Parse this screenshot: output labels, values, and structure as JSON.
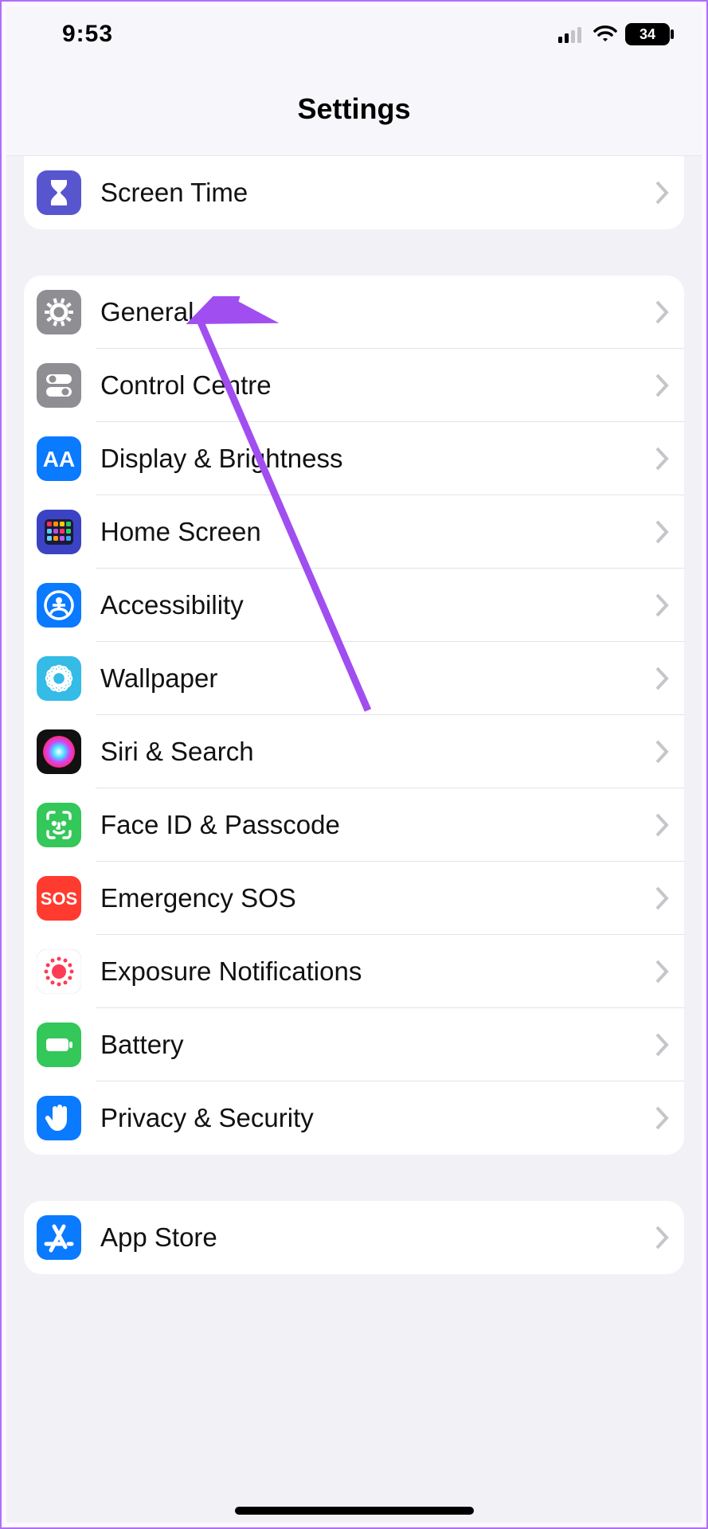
{
  "status_bar": {
    "time": "9:53",
    "battery_percent": "34"
  },
  "header": {
    "title": "Settings"
  },
  "groups": [
    {
      "partial_top": true,
      "rows": [
        {
          "key": "screen-time",
          "label": "Screen Time",
          "icon": "hourglass",
          "bg": "#5856cf"
        }
      ]
    },
    {
      "rows": [
        {
          "key": "general",
          "label": "General",
          "icon": "gear",
          "bg": "#8e8e93"
        },
        {
          "key": "control-centre",
          "label": "Control Centre",
          "icon": "toggles",
          "bg": "#8e8e93"
        },
        {
          "key": "display-brightness",
          "label": "Display & Brightness",
          "icon": "aa",
          "bg": "#0a7aff"
        },
        {
          "key": "home-screen",
          "label": "Home Screen",
          "icon": "homegrid",
          "bg": "#3b43c4"
        },
        {
          "key": "accessibility",
          "label": "Accessibility",
          "icon": "person-circle",
          "bg": "#0a7aff"
        },
        {
          "key": "wallpaper",
          "label": "Wallpaper",
          "icon": "flower",
          "bg": "#34bbe6"
        },
        {
          "key": "siri-search",
          "label": "Siri & Search",
          "icon": "siri",
          "bg": "#000000"
        },
        {
          "key": "faceid-passcode",
          "label": "Face ID & Passcode",
          "icon": "face",
          "bg": "#34c759"
        },
        {
          "key": "emergency-sos",
          "label": "Emergency SOS",
          "icon": "sos",
          "bg": "#ff3b30"
        },
        {
          "key": "exposure-notifications",
          "label": "Exposure Notifications",
          "icon": "exposure",
          "bg": "#ffffff"
        },
        {
          "key": "battery",
          "label": "Battery",
          "icon": "battery",
          "bg": "#34c759"
        },
        {
          "key": "privacy-security",
          "label": "Privacy & Security",
          "icon": "hand",
          "bg": "#0a7aff"
        }
      ]
    },
    {
      "rows": [
        {
          "key": "app-store",
          "label": "App Store",
          "icon": "appstore",
          "bg": "#0a7aff"
        }
      ]
    }
  ],
  "annotation": {
    "target": "general",
    "color": "#a14ef0"
  }
}
